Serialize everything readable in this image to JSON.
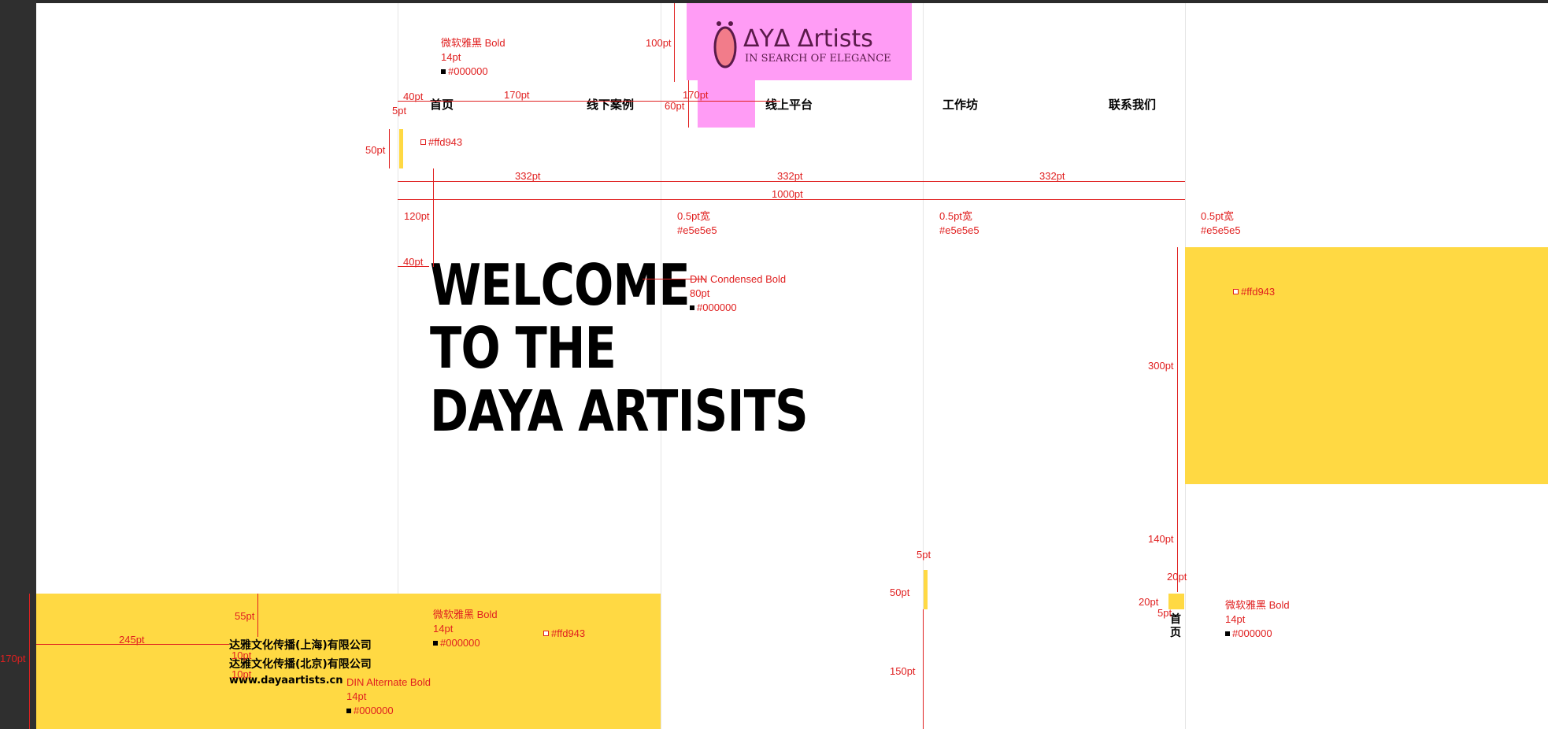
{
  "logo": {
    "brand": "ΔYΔ Δrtists",
    "tagline": "IN SEARCH OF ELEGANCE",
    "color": "#ff9cf5"
  },
  "nav": {
    "items": [
      "首页",
      "线下案例",
      "线上平台",
      "工作坊",
      "联系我们"
    ]
  },
  "hero": {
    "lines": [
      "WELCOME",
      "TO THE",
      "DAYA ARTISITS"
    ]
  },
  "footer": {
    "company_sh": "达雅文化传播(上海)有限公司",
    "company_bj": "达雅文化传播(北京)有限公司",
    "website": "www.dayaartists.cn"
  },
  "side_nav": {
    "label": "首\n页"
  },
  "annotations": {
    "font_nav": "微软雅黑 Bold",
    "size_14": "14pt",
    "color_black": "#000000",
    "color_yellow": "#ffd943",
    "color_line": "#e5e5e5",
    "line_width": "0.5pt宽",
    "font_hero": "DIN Condensed Bold",
    "size_80": "80pt",
    "font_url": "DIN Alternate Bold",
    "d_100": "100pt",
    "d_40": "40pt",
    "d_170": "170pt",
    "d_60": "60pt",
    "d_5": "5pt",
    "d_50": "50pt",
    "d_332": "332pt",
    "d_1000": "1000pt",
    "d_120": "120pt",
    "d_300": "300pt",
    "d_140": "140pt",
    "d_20": "20pt",
    "d_150": "150pt",
    "d_55": "55pt",
    "d_245": "245pt",
    "d_10": "10pt"
  }
}
